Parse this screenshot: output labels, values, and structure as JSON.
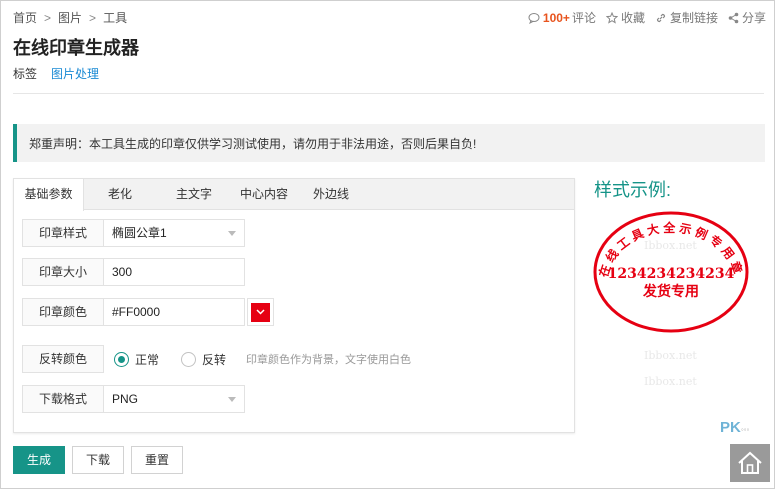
{
  "breadcrumb": {
    "home": "首页",
    "images": "图片",
    "tools": "工具"
  },
  "actions": {
    "comment_count": "100+",
    "comment_label": "评论",
    "favorite_label": "收藏",
    "copy_link_label": "复制链接",
    "share_label": "分享"
  },
  "page_title": "在线印章生成器",
  "tags": {
    "label": "标签",
    "items": [
      "图片处理"
    ]
  },
  "notice": "郑重声明：本工具生成的印章仅供学习测试使用，请勿用于非法用途，否则后果自负!",
  "tabs": [
    "基础参数",
    "老化",
    "主文字",
    "中心内容",
    "外边线"
  ],
  "form": {
    "style_label": "印章样式",
    "style_value": "椭圆公章1",
    "size_label": "印章大小",
    "size_value": "300",
    "color_label": "印章颜色",
    "color_value": "#FF0000",
    "invert_label": "反转颜色",
    "invert_normal": "正常",
    "invert_reverse": "反转",
    "invert_hint": "印章颜色作为背景，文字使用白色",
    "format_label": "下载格式",
    "format_value": "PNG"
  },
  "buttons": {
    "generate": "生成",
    "download": "下载",
    "reset": "重置"
  },
  "example": {
    "title": "样式示例:",
    "stamp_arc_text": "在线工具大全示例专用章",
    "stamp_number": "1234234234234",
    "stamp_bottom": "发货专用",
    "watermark": "Ibbox.net"
  },
  "logo": "PK",
  "colors": {
    "accent": "#169488",
    "stamp": "#e60012",
    "link": "#1a8ad4",
    "count": "#e8541e"
  }
}
